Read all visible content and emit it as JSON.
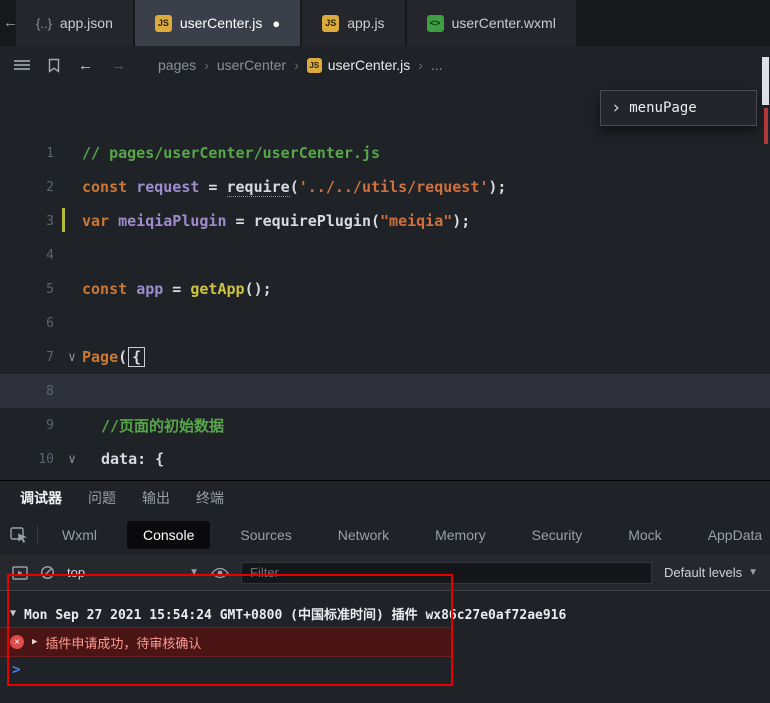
{
  "colors": {
    "annotation_red": "#e60000",
    "error_row_bg": "#4b1515",
    "prompt_blue": "#4e7fe0",
    "comment_green": "#57a64a",
    "keyword_orange": "#cc7832",
    "string_orange": "#d0703c"
  },
  "editor_tabs": [
    {
      "label": "app.json",
      "slug": "app-json",
      "icon": "braces",
      "active": false,
      "modified": false
    },
    {
      "label": "userCenter.js",
      "slug": "usercenter-js",
      "icon": "js",
      "active": true,
      "modified": true
    },
    {
      "label": "app.js",
      "slug": "app-js",
      "icon": "js",
      "active": false,
      "modified": false
    },
    {
      "label": "userCenter.wxml",
      "slug": "usercenter-wxml",
      "icon": "wxml",
      "active": false,
      "modified": false
    }
  ],
  "breadcrumb": {
    "items": [
      {
        "label": "pages",
        "bright": false
      },
      {
        "label": "userCenter",
        "bright": false
      },
      {
        "label": "userCenter.js",
        "bright": true,
        "icon": "js"
      },
      {
        "label": "...",
        "bright": false
      }
    ],
    "separator": "›"
  },
  "outline_popup": {
    "chevron": "›",
    "label": "menuPage"
  },
  "editor": {
    "lines": [
      {
        "n": "1",
        "indent": 0,
        "tokens": [
          [
            "comment",
            "// pages/userCenter/userCenter.js"
          ]
        ]
      },
      {
        "n": "2",
        "indent": 0,
        "tokens": [
          [
            "kw",
            "const"
          ],
          [
            "plain",
            " "
          ],
          [
            "var",
            "request"
          ],
          [
            "plain",
            " = "
          ],
          [
            "hint",
            "require"
          ],
          [
            "plain",
            "("
          ],
          [
            "str",
            "'../../utils/request'"
          ],
          [
            "plain",
            ");"
          ]
        ]
      },
      {
        "n": "3",
        "indent": 0,
        "changed": true,
        "tokens": [
          [
            "kw",
            "var"
          ],
          [
            "plain",
            " "
          ],
          [
            "var",
            "meiqiaPlugin"
          ],
          [
            "plain",
            " = "
          ],
          [
            "plain",
            "requirePlugin"
          ],
          [
            "plain",
            "("
          ],
          [
            "str",
            "\"meiqia\""
          ],
          [
            "plain",
            ");"
          ]
        ]
      },
      {
        "n": "4",
        "indent": 0,
        "tokens": []
      },
      {
        "n": "5",
        "indent": 0,
        "tokens": [
          [
            "kw",
            "const"
          ],
          [
            "plain",
            " "
          ],
          [
            "var",
            "app"
          ],
          [
            "plain",
            " = "
          ],
          [
            "fn",
            "getApp"
          ],
          [
            "plain",
            "();"
          ]
        ]
      },
      {
        "n": "6",
        "indent": 0,
        "tokens": []
      },
      {
        "n": "7",
        "indent": 0,
        "fold": true,
        "tokens": [
          [
            "kw",
            "Page"
          ],
          [
            "plain",
            "("
          ],
          [
            "cursor",
            "{"
          ]
        ]
      },
      {
        "n": "8",
        "indent": 0,
        "current": true,
        "tokens": []
      },
      {
        "n": "9",
        "indent": 1,
        "tokens": [
          [
            "comment",
            "//页面的初始数据"
          ]
        ]
      },
      {
        "n": "10",
        "indent": 1,
        "fold": true,
        "tokens": [
          [
            "plain",
            "data: {"
          ]
        ]
      }
    ]
  },
  "panel": {
    "tabs": [
      {
        "label": "调试器",
        "slug": "debugger",
        "active": true
      },
      {
        "label": "问题",
        "slug": "problems",
        "active": false
      },
      {
        "label": "输出",
        "slug": "output",
        "active": false
      },
      {
        "label": "终端",
        "slug": "terminal",
        "active": false
      }
    ],
    "devtools_tabs": [
      {
        "label": "Wxml",
        "active": false
      },
      {
        "label": "Console",
        "active": true
      },
      {
        "label": "Sources",
        "active": false
      },
      {
        "label": "Network",
        "active": false
      },
      {
        "label": "Memory",
        "active": false
      },
      {
        "label": "Security",
        "active": false
      },
      {
        "label": "Mock",
        "active": false
      },
      {
        "label": "AppData",
        "active": false
      }
    ],
    "toolbar": {
      "context": "top",
      "filter_placeholder": "Filter",
      "levels": "Default levels"
    },
    "console": {
      "group_line": "Mon Sep 27 2021 15:54:24 GMT+0800 (中国标准时间) 插件 wx86c27e0af72ae916",
      "error_line": "插件申请成功，待审核确认",
      "prompt": ">"
    }
  }
}
